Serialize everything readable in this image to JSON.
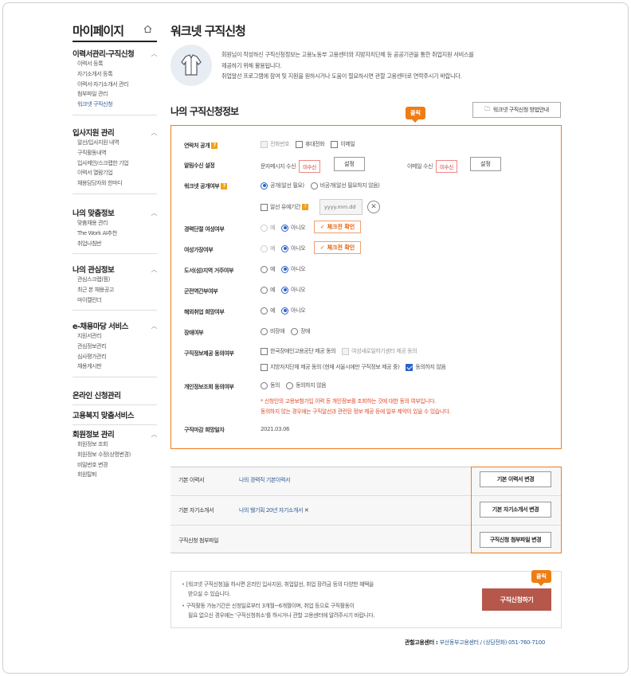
{
  "sidebar": {
    "title": "마이페이지",
    "groups": [
      {
        "header": "이력서관리·구직신청",
        "items": [
          "이력서 등록",
          "자기소개서 등록",
          "이력서·자기소개서 관리",
          "첨부파일 관리",
          "워크넷 구직신청"
        ]
      },
      {
        "header": "입사지원 관리",
        "items": [
          "알선/입사지원 내역",
          "구직활동내역",
          "입사제안/스크랩한 기업",
          "이력서 열람기업",
          "채용담당자와 한마디"
        ]
      },
      {
        "header": "나의 맞춤정보",
        "items": [
          "맞춤채용 관리",
          "The Work AI추천",
          "취업나침반"
        ]
      },
      {
        "header": "나의 관심정보",
        "items": [
          "관심스크랩(찜)",
          "최근 본 채용공고",
          "마이캘린더"
        ]
      },
      {
        "header": "e-채용마당 서비스",
        "items": [
          "지원서관리",
          "관심정보관리",
          "심사평가관리",
          "채용게시판"
        ]
      }
    ],
    "single": [
      "온라인 신청관리",
      "고용복지 맞춤서비스"
    ],
    "last": {
      "header": "회원정보 관리",
      "items": [
        "회원정보 조회",
        "회원정보 수정(상명변경)",
        "비밀번호 변경",
        "회원탈퇴"
      ]
    }
  },
  "page": {
    "title": "워크넷 구직신청",
    "intro1": "회원님이 작성하신 구직신청정보는 고용노동부 고용센터와 지방자치단체 등 공공기관을 통한 취업지원 서비스를",
    "intro2": "제공하기 위해 활용됩니다.",
    "intro3": "취업알선 프로그램에 참여 및 지원을 원하시거나 도움이 필요하시면 관할 고용센터로 연락주시기 바랍니다.",
    "section_title": "나의 구직신청정보",
    "guide_button": "워크넷 구직신청 방법안내",
    "click_tip": "클릭"
  },
  "form": {
    "contact_label": "연락처 공개",
    "contact_opts": [
      "전화번호",
      "휴대전화",
      "이메일"
    ],
    "notify_label": "알림수신 설정",
    "sms_label": "문자메시지 수신",
    "email_label": "이메일 수신",
    "unset_badge": "미수신",
    "set_button": "설정",
    "public_label": "워크넷 공개여부",
    "public_opt1": "공개(알선 필요)",
    "public_opt2": "비공개(알선 필요하지 않음)",
    "hold_label": "알선 유예기간",
    "date_placeholder": "yyyy.mm.dd",
    "career_label": "경력단절 여성여부",
    "family_label": "여성가장여부",
    "yes": "예",
    "no": "아니오",
    "check_button": "체크전 확인",
    "island_label": "도서(섬)지역 거주여부",
    "military_label": "군전역간부여부",
    "overseas_label": "해외취업 희망여부",
    "disabled_label": "장애여부",
    "nondisabled": "비장애",
    "disabled": "장애",
    "consent_label": "구직정보제공 동의여부",
    "consent1": "한국장애인고용공단 제공 동의",
    "consent2": "여성새로일하기센터 제공 동의",
    "consent3": "지방자치단체 제공 동의 (현재 서울시에만 구직정보 제공 중)",
    "consent4": "동의하지 않음",
    "privacy_label": "개인정보조회 동의여부",
    "agree": "동의",
    "disagree": "동의하지 않음",
    "note1": "* 신청인의 고용보험가입 이력 등 개인정보를 조회하는 것에 대한 동의 여부입니다.",
    "note2": "동의하지 않는 경우에는 구직알선과 관련된 정보 제공 등에 일부 제약이 있을 수 있습니다.",
    "deadline_label": "구직마감 희망일자",
    "deadline_value": "2021.03.06"
  },
  "resume": {
    "rows": [
      {
        "key": "기본 이력서",
        "value": "나의 경력직 기본이력서",
        "button": "기본 이력서 변경"
      },
      {
        "key": "기본 자기소개서",
        "value": "나의 웰기획 20년 자기소개서",
        "button": "기본 자기소개서 변경"
      },
      {
        "key": "구직신청 첨부파일",
        "value": "",
        "button": "구직신청 첨부파일 변경"
      }
    ]
  },
  "bottom": {
    "line1": "[워크넷 구직신청]을 하시면 온라인 입사지원, 취업알선, 취업 장려금 등의 다양한 혜택을",
    "line2": "받으실 수 있습니다.",
    "line3": "구직활동 가능기간은 신청일로부터 3개월~6개월이며, 취업 등으로 구직활동이",
    "line4": "필요 없으신 경우에는 '구직신청취소'를 하시거나 관할 고용센터에 알려주시기 바랍니다.",
    "apply_button": "구직신청하기"
  },
  "footer": {
    "label": "관할고용센터 : ",
    "center": "부산동부고용센터",
    "phone": " / (상담전화) 051-760-7100"
  }
}
